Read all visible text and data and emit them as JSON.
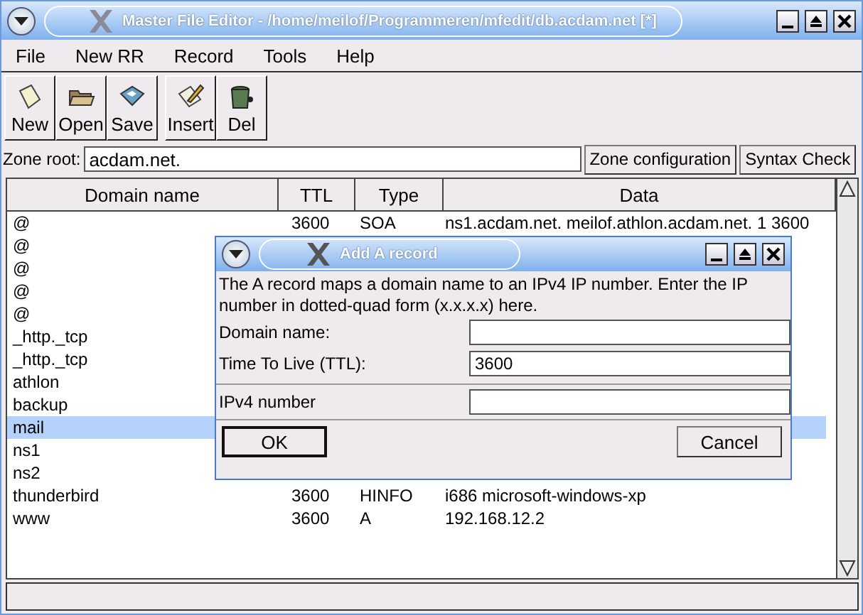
{
  "window": {
    "title": "Master File Editor - /home/meilof/Programmeren/mfedit/db.acdam.net [*]"
  },
  "menu": [
    "File",
    "New RR",
    "Record",
    "Tools",
    "Help"
  ],
  "toolbar": [
    {
      "label": "New",
      "kind": "new"
    },
    {
      "label": "Open",
      "kind": "open"
    },
    {
      "label": "Save",
      "kind": "save"
    },
    {
      "label": "Insert",
      "kind": "insert"
    },
    {
      "label": "Del",
      "kind": "delete"
    }
  ],
  "zone": {
    "label": "Zone root:",
    "value": "acdam.net.",
    "buttons": [
      "Zone configuration",
      "Syntax Check"
    ]
  },
  "table": {
    "columns": [
      "Domain name",
      "TTL",
      "Type",
      "Data"
    ],
    "rows": [
      {
        "domain": "@",
        "ttl": "3600",
        "type": "SOA",
        "data": "ns1.acdam.net. meilof.athlon.acdam.net. 1 3600",
        "selected": false
      },
      {
        "domain": "@",
        "selected": false
      },
      {
        "domain": "@",
        "selected": false
      },
      {
        "domain": "@",
        "selected": false
      },
      {
        "domain": "@",
        "selected": false
      },
      {
        "domain": "_http._tcp",
        "selected": false
      },
      {
        "domain": "_http._tcp",
        "selected": false
      },
      {
        "domain": "athlon",
        "selected": false
      },
      {
        "domain": "backup",
        "selected": false
      },
      {
        "domain": "mail",
        "selected": true
      },
      {
        "domain": "ns1",
        "selected": false
      },
      {
        "domain": "ns2",
        "selected": false
      },
      {
        "domain": "thunderbird",
        "ttl": "3600",
        "type": "HINFO",
        "data": "i686 microsoft-windows-xp",
        "selected": false
      },
      {
        "domain": "www",
        "ttl": "3600",
        "type": "A",
        "data": "192.168.12.2",
        "selected": false
      }
    ]
  },
  "dialog": {
    "title": "Add A record",
    "description": "The A record maps a domain name to an IPv4 IP number. Enter the IP number in dotted-quad form (x.x.x.x) here.",
    "fields": [
      {
        "label": "Domain name:"
      },
      {
        "label": "Time To Live (TTL):",
        "value": "3600"
      },
      {
        "label": "IPv4 number"
      }
    ],
    "buttons": [
      "OK",
      "Cancel"
    ]
  }
}
